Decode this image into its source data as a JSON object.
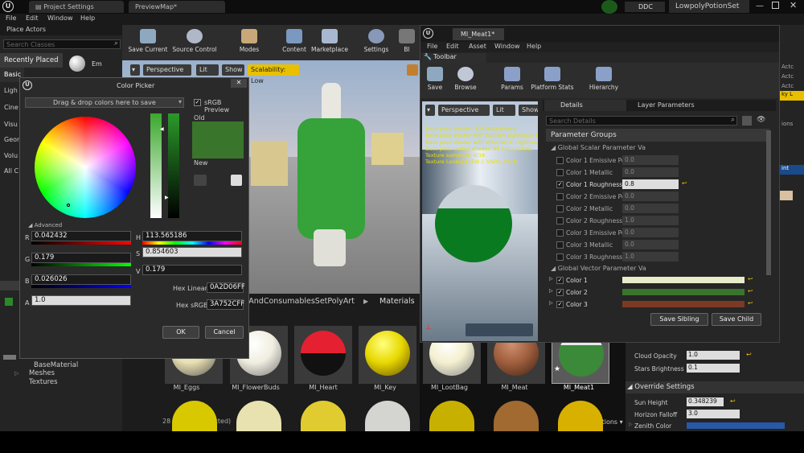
{
  "tabs": {
    "project_settings": "Project Settings",
    "preview_map": "PreviewMap*",
    "ddc": "DDC",
    "project": "LowpolyPotionSet"
  },
  "menu": {
    "file": "File",
    "edit": "Edit",
    "window": "Window",
    "help": "Help"
  },
  "place_actors": {
    "title": "Place Actors",
    "search_placeholder": "Search Classes",
    "categories": [
      "Recently Placed",
      "Basic",
      "Ligh",
      "Cine",
      "Visu",
      "Geon",
      "Volu",
      "All C"
    ],
    "item_label": "Em"
  },
  "toolbar": {
    "save_current": "Save Current",
    "source_control": "Source Control",
    "modes": "Modes",
    "content": "Content",
    "marketplace": "Marketplace",
    "settings": "Settings",
    "build": "Bl"
  },
  "viewport": {
    "perspective": "Perspective",
    "lit": "Lit",
    "show": "Show",
    "scalability": "Scalability: Low"
  },
  "content_browser": {
    "path": "ablesAndConsumablesSetPolyArt",
    "path_sep": "▶",
    "folder": "Materials",
    "tree": [
      "BaseMaterial",
      "Meshes",
      "Textures"
    ],
    "items_count": "28 items (1 selected)",
    "view_options": "View Options",
    "assets": [
      {
        "name": "MI_Eggs",
        "color": "#e8e0b0"
      },
      {
        "name": "MI_FlowerBuds",
        "color": "#f0eee0"
      },
      {
        "name": "MI_Heart",
        "color": "#d41c2c"
      },
      {
        "name": "MI_Key",
        "color": "#e8d800"
      },
      {
        "name": "MI_LootBag",
        "color": "#f4f0d0"
      },
      {
        "name": "MI_Meat",
        "color": "#a06040"
      },
      {
        "name": "MI_Meat1",
        "color": "#3a8a3a"
      }
    ]
  },
  "color_picker": {
    "title": "Color Picker",
    "drag_drop": "Drag & drop colors here to save",
    "srgb_preview": "sRGB Preview",
    "old": "Old",
    "new": "New",
    "advanced": "Advanced",
    "r_label": "R",
    "r": "0.042432",
    "g_label": "G",
    "g": "0.179",
    "b_label": "B",
    "b": "0.026026",
    "a_label": "A",
    "a": "1.0",
    "h_label": "H",
    "h": "113.565186",
    "s_label": "S",
    "s": "0.854603",
    "v_label": "V",
    "v": "0.179",
    "hex_linear_label": "Hex Linear",
    "hex_linear": "0A2D06FF",
    "hex_srgb_label": "Hex sRGB",
    "hex_srgb": "3A752CFF",
    "ok": "OK",
    "cancel": "Cancel",
    "color_old": "#3a752c",
    "color_new": "#3a752c"
  },
  "material_editor": {
    "tab": "MI_Meat1*",
    "menu": {
      "file": "File",
      "edit": "Edit",
      "asset": "Asset",
      "window": "Window",
      "help": "Help"
    },
    "toolbar_label": "Toolbar",
    "buttons": {
      "save": "Save",
      "browse": "Browse",
      "params": "Params",
      "platform_stats": "Platform Stats",
      "hierarchy": "Hierarchy"
    },
    "preview": {
      "perspective": "Perspective",
      "lit": "Lit",
      "show": "Show",
      "stats": [
        "Base pass shader: 134 instructions",
        "Base pass shader with Surface Lightmap: 6",
        "Base pass shader with Volumetric Lightmap: 2",
        "Base pass vertex shader: 46 instructions",
        "Texture samplers: 4/16",
        "Texture Lookups (Est.): VS(0), PS(4)"
      ]
    },
    "details_tab": "Details",
    "layer_params_tab": "Layer Parameters",
    "search_placeholder": "Search Details",
    "parameter_groups": "Parameter Groups",
    "scalar_group": "Global Scalar Parameter Va",
    "scalar_params": [
      {
        "name": "Color 1 Emissive Powe",
        "value": "0.0",
        "checked": false
      },
      {
        "name": "Color 1 Metallic",
        "value": "0.0",
        "checked": false
      },
      {
        "name": "Color 1 Roughness",
        "value": "0.8",
        "checked": true
      },
      {
        "name": "Color 2 Emissive Powe",
        "value": "0.0",
        "checked": false
      },
      {
        "name": "Color 2 Metallic",
        "value": "0.0",
        "checked": false
      },
      {
        "name": "Color 2 Roughness",
        "value": "1.0",
        "checked": false
      },
      {
        "name": "Color 3 Emissive Powe",
        "value": "0.0",
        "checked": false
      },
      {
        "name": "Color 3 Metallic",
        "value": "0.0",
        "checked": false
      },
      {
        "name": "Color 3 Roughness",
        "value": "1.0",
        "checked": false
      }
    ],
    "vector_group": "Global Vector Parameter Va",
    "vector_params": [
      {
        "name": "Color 1",
        "color": "#e8ecc8"
      },
      {
        "name": "Color 2",
        "color": "#3a752c"
      },
      {
        "name": "Color 3",
        "color": "#7a3a24"
      }
    ],
    "save_sibling": "Save Sibling",
    "save_child": "Save Child"
  },
  "sky_panel": {
    "cloud_opacity_label": "Cloud Opacity",
    "cloud_opacity": "1.0",
    "stars_brightness_label": "Stars Brightness",
    "stars_brightness": "0.1",
    "override_settings": "Override Settings",
    "sun_height_label": "Sun Height",
    "sun_height": "0.348239",
    "horizon_falloff_label": "Horizon Falloff",
    "horizon_falloff": "3.0",
    "zenith_color_label": "Zenith Color"
  },
  "right_edge": {
    "items": [
      "Actc",
      "Actc",
      "Actc",
      "ky L",
      "ions",
      "int"
    ]
  }
}
